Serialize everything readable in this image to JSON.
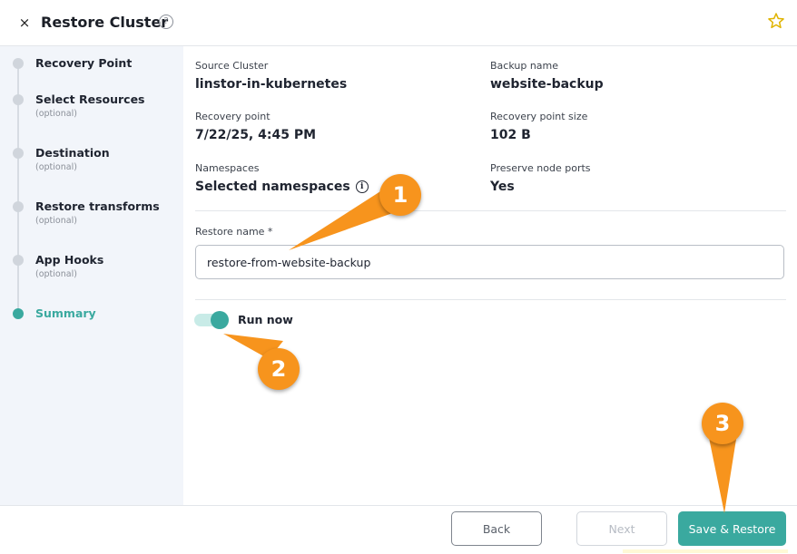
{
  "header": {
    "close_glyph": "×",
    "title": "Restore Cluster",
    "help_glyph": "?",
    "favorite_glyph": "☆"
  },
  "sidebar": {
    "steps": [
      {
        "label": "Recovery Point",
        "sub": ""
      },
      {
        "label": "Select Resources",
        "sub": "(optional)"
      },
      {
        "label": "Destination",
        "sub": "(optional)"
      },
      {
        "label": "Restore transforms",
        "sub": "(optional)"
      },
      {
        "label": "App Hooks",
        "sub": "(optional)"
      },
      {
        "label": "Summary",
        "sub": ""
      }
    ],
    "active_step": "Summary"
  },
  "summary": {
    "source_cluster": {
      "label": "Source Cluster",
      "value": "linstor-in-kubernetes"
    },
    "backup_name": {
      "label": "Backup name",
      "value": "website-backup"
    },
    "recovery_point": {
      "label": "Recovery point",
      "value": "7/22/25, 4:45 PM"
    },
    "recovery_point_size": {
      "label": "Recovery point size",
      "value": "102 B"
    },
    "namespaces": {
      "label": "Namespaces",
      "value": "Selected namespaces",
      "info_glyph": "i"
    },
    "preserve_node_ports": {
      "label": "Preserve node ports",
      "value": "Yes"
    }
  },
  "restore_name": {
    "label": "Restore name *",
    "value": "restore-from-website-backup"
  },
  "run_now": {
    "label": "Run now",
    "enabled": true
  },
  "footer": {
    "back_label": "Back",
    "next_label": "Next",
    "save_label": "Save & Restore"
  },
  "callouts": [
    "1",
    "2",
    "3"
  ],
  "colors": {
    "accent": "#3aa99f",
    "callout": "#f7941d",
    "sidebar_bg": "#f2f5fa"
  }
}
